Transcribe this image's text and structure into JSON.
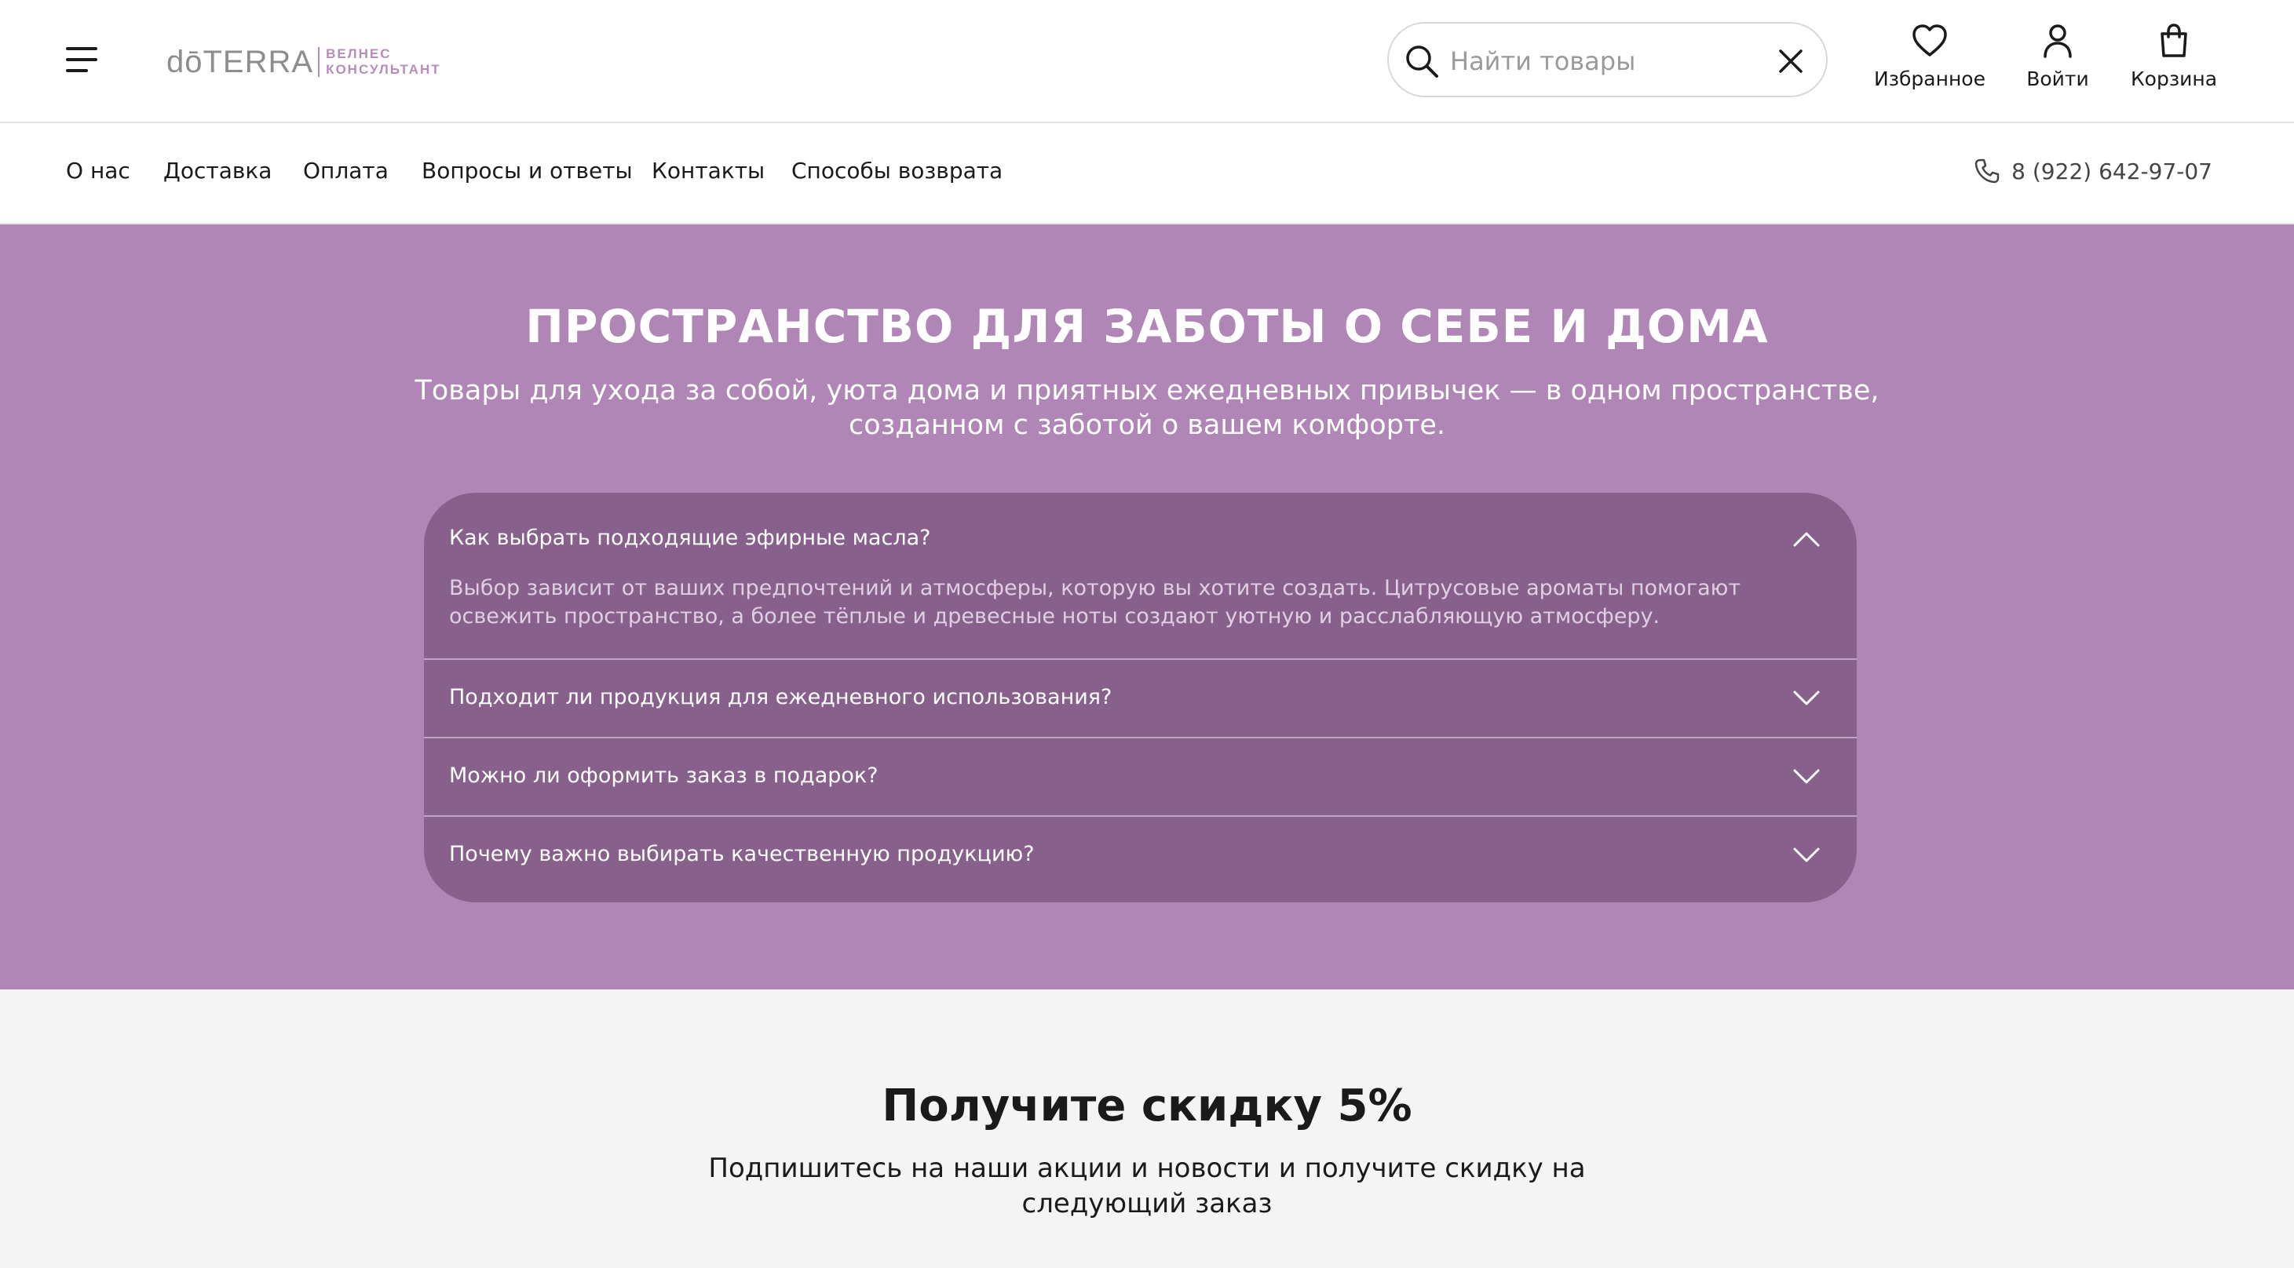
{
  "header": {
    "logo": {
      "main": "dōTERRA",
      "sub_line1": "ВЕЛНЕС",
      "sub_line2": "КОНСУЛЬТАНТ"
    },
    "search": {
      "placeholder": "Найти товары",
      "value": ""
    },
    "favorites_label": "Избранное",
    "login_label": "Войти",
    "cart_label": "Корзина"
  },
  "nav": {
    "items": [
      "О нас",
      "Доставка",
      "Оплата",
      "Вопросы и ответы",
      "Контакты",
      "Способы возврата"
    ],
    "phone": "8 (922) 642-97-07"
  },
  "hero": {
    "title": "ПРОСТРАНСТВО ДЛЯ ЗАБОТЫ О СЕБЕ И ДОМА",
    "subtitle": "Товары для ухода за собой, уюта дома и приятных ежедневных привычек — в одном пространстве, созданном с заботой о вашем комфорте."
  },
  "faq": {
    "items": [
      {
        "question": "Как выбрать подходящие эфирные масла?",
        "answer": "Выбор зависит от ваших предпочтений и атмосферы, которую вы хотите создать. Цитрусовые ароматы помогают освежить пространство, а более тёплые и древесные ноты создают уютную и расслабляющую атмосферу.",
        "expanded": true
      },
      {
        "question": "Подходит ли продукция для ежедневного использования?",
        "expanded": false
      },
      {
        "question": "Можно ли оформить заказ в подарок?",
        "expanded": false
      },
      {
        "question": "Почему важно выбирать качественную продукцию?",
        "expanded": false
      }
    ]
  },
  "subscribe": {
    "title": "Получите скидку 5%",
    "text": "Подпишитесь на наши акции и новости и получите скидку на следующий заказ"
  },
  "colors": {
    "hero_bg": "#b086b6",
    "faq_bg": "#87618c",
    "accent": "#b98bbd",
    "subscribe_bg": "#f4f4f4"
  },
  "icons": [
    "menu-icon",
    "search-icon",
    "close-icon",
    "heart-icon",
    "user-icon",
    "bag-icon",
    "phone-icon",
    "chevron-up-icon",
    "chevron-down-icon"
  ]
}
